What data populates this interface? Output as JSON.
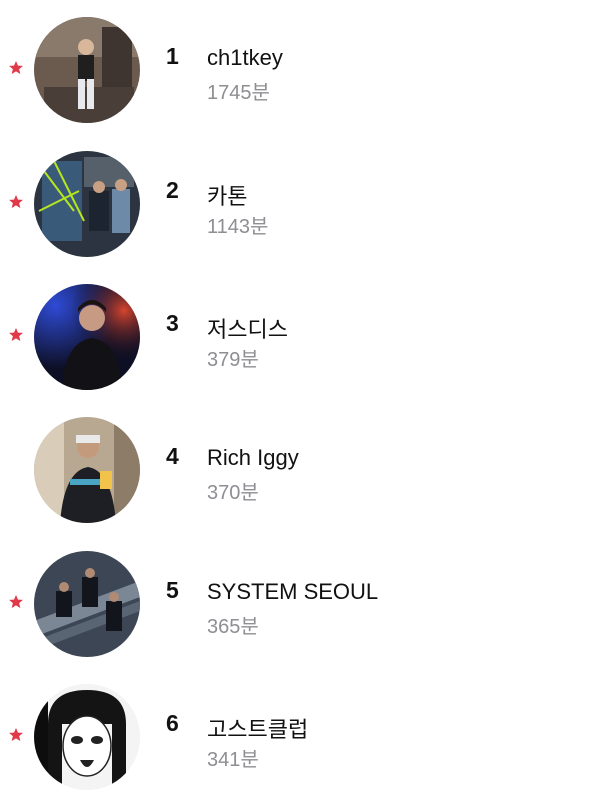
{
  "colors": {
    "star": "#e0394a",
    "rank": "#111111",
    "name": "#111111",
    "minutes": "#8e8e93",
    "background": "#ffffff"
  },
  "star_icon": "star-icon",
  "entries": [
    {
      "rank": "1",
      "name": "ch1tkey",
      "minutes": "1745분",
      "starred": true,
      "avatar_icon": "artist-photo"
    },
    {
      "rank": "2",
      "name": "카톤",
      "minutes": "1143분",
      "starred": true,
      "avatar_icon": "artist-photo"
    },
    {
      "rank": "3",
      "name": "저스디스",
      "minutes": "379분",
      "starred": true,
      "avatar_icon": "artist-photo"
    },
    {
      "rank": "4",
      "name": "Rich Iggy",
      "minutes": "370분",
      "starred": false,
      "avatar_icon": "artist-photo"
    },
    {
      "rank": "5",
      "name": "SYSTEM SEOUL",
      "minutes": "365분",
      "starred": true,
      "avatar_icon": "artist-photo"
    },
    {
      "rank": "6",
      "name": "고스트클럽",
      "minutes": "341분",
      "starred": true,
      "avatar_icon": "artist-illustration"
    }
  ]
}
